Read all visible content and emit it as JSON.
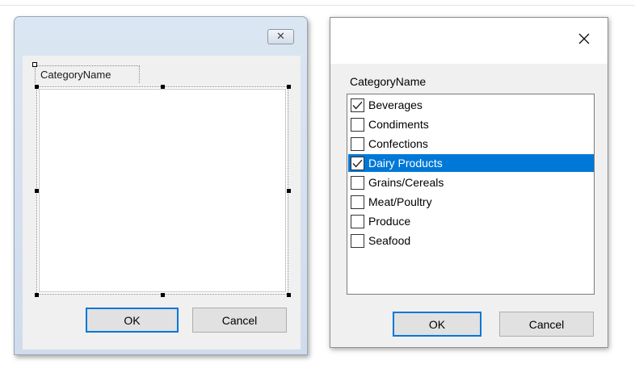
{
  "designer_dialog": {
    "tab_label": "CategoryName",
    "ok_label": "OK",
    "cancel_label": "Cancel",
    "close_glyph": "✕"
  },
  "runtime_dialog": {
    "close_glyph": "✕",
    "list_caption": "CategoryName",
    "items": [
      {
        "label": "Beverages",
        "checked": true,
        "selected": false
      },
      {
        "label": "Condiments",
        "checked": false,
        "selected": false
      },
      {
        "label": "Confections",
        "checked": false,
        "selected": false
      },
      {
        "label": "Dairy Products",
        "checked": true,
        "selected": true
      },
      {
        "label": "Grains/Cereals",
        "checked": false,
        "selected": false
      },
      {
        "label": "Meat/Poultry",
        "checked": false,
        "selected": false
      },
      {
        "label": "Produce",
        "checked": false,
        "selected": false
      },
      {
        "label": "Seafood",
        "checked": false,
        "selected": false
      }
    ],
    "ok_label": "OK",
    "cancel_label": "Cancel"
  },
  "colors": {
    "selection": "#0078d7",
    "default_button_border": "#0078d7"
  },
  "icons": {
    "designer_close": "close-icon",
    "runtime_close": "close-icon",
    "check": "checkmark-icon"
  }
}
